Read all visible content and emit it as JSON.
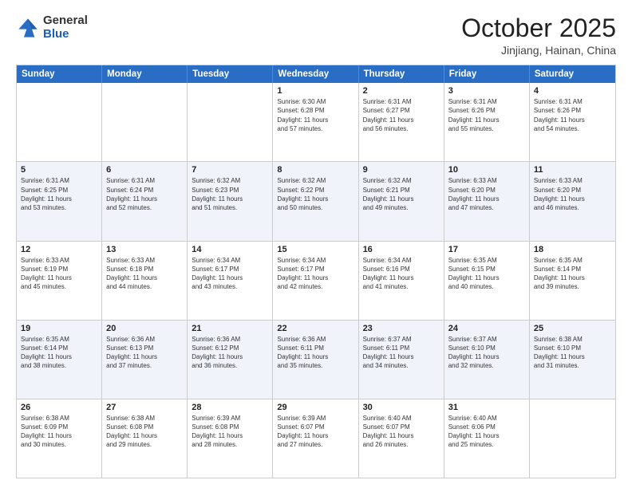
{
  "header": {
    "logo_general": "General",
    "logo_blue": "Blue",
    "title": "October 2025",
    "location": "Jinjiang, Hainan, China"
  },
  "days_of_week": [
    "Sunday",
    "Monday",
    "Tuesday",
    "Wednesday",
    "Thursday",
    "Friday",
    "Saturday"
  ],
  "rows": [
    {
      "alt": false,
      "cells": [
        {
          "day": "",
          "lines": []
        },
        {
          "day": "",
          "lines": []
        },
        {
          "day": "",
          "lines": []
        },
        {
          "day": "1",
          "lines": [
            "Sunrise: 6:30 AM",
            "Sunset: 6:28 PM",
            "Daylight: 11 hours",
            "and 57 minutes."
          ]
        },
        {
          "day": "2",
          "lines": [
            "Sunrise: 6:31 AM",
            "Sunset: 6:27 PM",
            "Daylight: 11 hours",
            "and 56 minutes."
          ]
        },
        {
          "day": "3",
          "lines": [
            "Sunrise: 6:31 AM",
            "Sunset: 6:26 PM",
            "Daylight: 11 hours",
            "and 55 minutes."
          ]
        },
        {
          "day": "4",
          "lines": [
            "Sunrise: 6:31 AM",
            "Sunset: 6:26 PM",
            "Daylight: 11 hours",
            "and 54 minutes."
          ]
        }
      ]
    },
    {
      "alt": true,
      "cells": [
        {
          "day": "5",
          "lines": [
            "Sunrise: 6:31 AM",
            "Sunset: 6:25 PM",
            "Daylight: 11 hours",
            "and 53 minutes."
          ]
        },
        {
          "day": "6",
          "lines": [
            "Sunrise: 6:31 AM",
            "Sunset: 6:24 PM",
            "Daylight: 11 hours",
            "and 52 minutes."
          ]
        },
        {
          "day": "7",
          "lines": [
            "Sunrise: 6:32 AM",
            "Sunset: 6:23 PM",
            "Daylight: 11 hours",
            "and 51 minutes."
          ]
        },
        {
          "day": "8",
          "lines": [
            "Sunrise: 6:32 AM",
            "Sunset: 6:22 PM",
            "Daylight: 11 hours",
            "and 50 minutes."
          ]
        },
        {
          "day": "9",
          "lines": [
            "Sunrise: 6:32 AM",
            "Sunset: 6:21 PM",
            "Daylight: 11 hours",
            "and 49 minutes."
          ]
        },
        {
          "day": "10",
          "lines": [
            "Sunrise: 6:33 AM",
            "Sunset: 6:20 PM",
            "Daylight: 11 hours",
            "and 47 minutes."
          ]
        },
        {
          "day": "11",
          "lines": [
            "Sunrise: 6:33 AM",
            "Sunset: 6:20 PM",
            "Daylight: 11 hours",
            "and 46 minutes."
          ]
        }
      ]
    },
    {
      "alt": false,
      "cells": [
        {
          "day": "12",
          "lines": [
            "Sunrise: 6:33 AM",
            "Sunset: 6:19 PM",
            "Daylight: 11 hours",
            "and 45 minutes."
          ]
        },
        {
          "day": "13",
          "lines": [
            "Sunrise: 6:33 AM",
            "Sunset: 6:18 PM",
            "Daylight: 11 hours",
            "and 44 minutes."
          ]
        },
        {
          "day": "14",
          "lines": [
            "Sunrise: 6:34 AM",
            "Sunset: 6:17 PM",
            "Daylight: 11 hours",
            "and 43 minutes."
          ]
        },
        {
          "day": "15",
          "lines": [
            "Sunrise: 6:34 AM",
            "Sunset: 6:17 PM",
            "Daylight: 11 hours",
            "and 42 minutes."
          ]
        },
        {
          "day": "16",
          "lines": [
            "Sunrise: 6:34 AM",
            "Sunset: 6:16 PM",
            "Daylight: 11 hours",
            "and 41 minutes."
          ]
        },
        {
          "day": "17",
          "lines": [
            "Sunrise: 6:35 AM",
            "Sunset: 6:15 PM",
            "Daylight: 11 hours",
            "and 40 minutes."
          ]
        },
        {
          "day": "18",
          "lines": [
            "Sunrise: 6:35 AM",
            "Sunset: 6:14 PM",
            "Daylight: 11 hours",
            "and 39 minutes."
          ]
        }
      ]
    },
    {
      "alt": true,
      "cells": [
        {
          "day": "19",
          "lines": [
            "Sunrise: 6:35 AM",
            "Sunset: 6:14 PM",
            "Daylight: 11 hours",
            "and 38 minutes."
          ]
        },
        {
          "day": "20",
          "lines": [
            "Sunrise: 6:36 AM",
            "Sunset: 6:13 PM",
            "Daylight: 11 hours",
            "and 37 minutes."
          ]
        },
        {
          "day": "21",
          "lines": [
            "Sunrise: 6:36 AM",
            "Sunset: 6:12 PM",
            "Daylight: 11 hours",
            "and 36 minutes."
          ]
        },
        {
          "day": "22",
          "lines": [
            "Sunrise: 6:36 AM",
            "Sunset: 6:11 PM",
            "Daylight: 11 hours",
            "and 35 minutes."
          ]
        },
        {
          "day": "23",
          "lines": [
            "Sunrise: 6:37 AM",
            "Sunset: 6:11 PM",
            "Daylight: 11 hours",
            "and 34 minutes."
          ]
        },
        {
          "day": "24",
          "lines": [
            "Sunrise: 6:37 AM",
            "Sunset: 6:10 PM",
            "Daylight: 11 hours",
            "and 32 minutes."
          ]
        },
        {
          "day": "25",
          "lines": [
            "Sunrise: 6:38 AM",
            "Sunset: 6:10 PM",
            "Daylight: 11 hours",
            "and 31 minutes."
          ]
        }
      ]
    },
    {
      "alt": false,
      "cells": [
        {
          "day": "26",
          "lines": [
            "Sunrise: 6:38 AM",
            "Sunset: 6:09 PM",
            "Daylight: 11 hours",
            "and 30 minutes."
          ]
        },
        {
          "day": "27",
          "lines": [
            "Sunrise: 6:38 AM",
            "Sunset: 6:08 PM",
            "Daylight: 11 hours",
            "and 29 minutes."
          ]
        },
        {
          "day": "28",
          "lines": [
            "Sunrise: 6:39 AM",
            "Sunset: 6:08 PM",
            "Daylight: 11 hours",
            "and 28 minutes."
          ]
        },
        {
          "day": "29",
          "lines": [
            "Sunrise: 6:39 AM",
            "Sunset: 6:07 PM",
            "Daylight: 11 hours",
            "and 27 minutes."
          ]
        },
        {
          "day": "30",
          "lines": [
            "Sunrise: 6:40 AM",
            "Sunset: 6:07 PM",
            "Daylight: 11 hours",
            "and 26 minutes."
          ]
        },
        {
          "day": "31",
          "lines": [
            "Sunrise: 6:40 AM",
            "Sunset: 6:06 PM",
            "Daylight: 11 hours",
            "and 25 minutes."
          ]
        },
        {
          "day": "",
          "lines": []
        }
      ]
    }
  ]
}
